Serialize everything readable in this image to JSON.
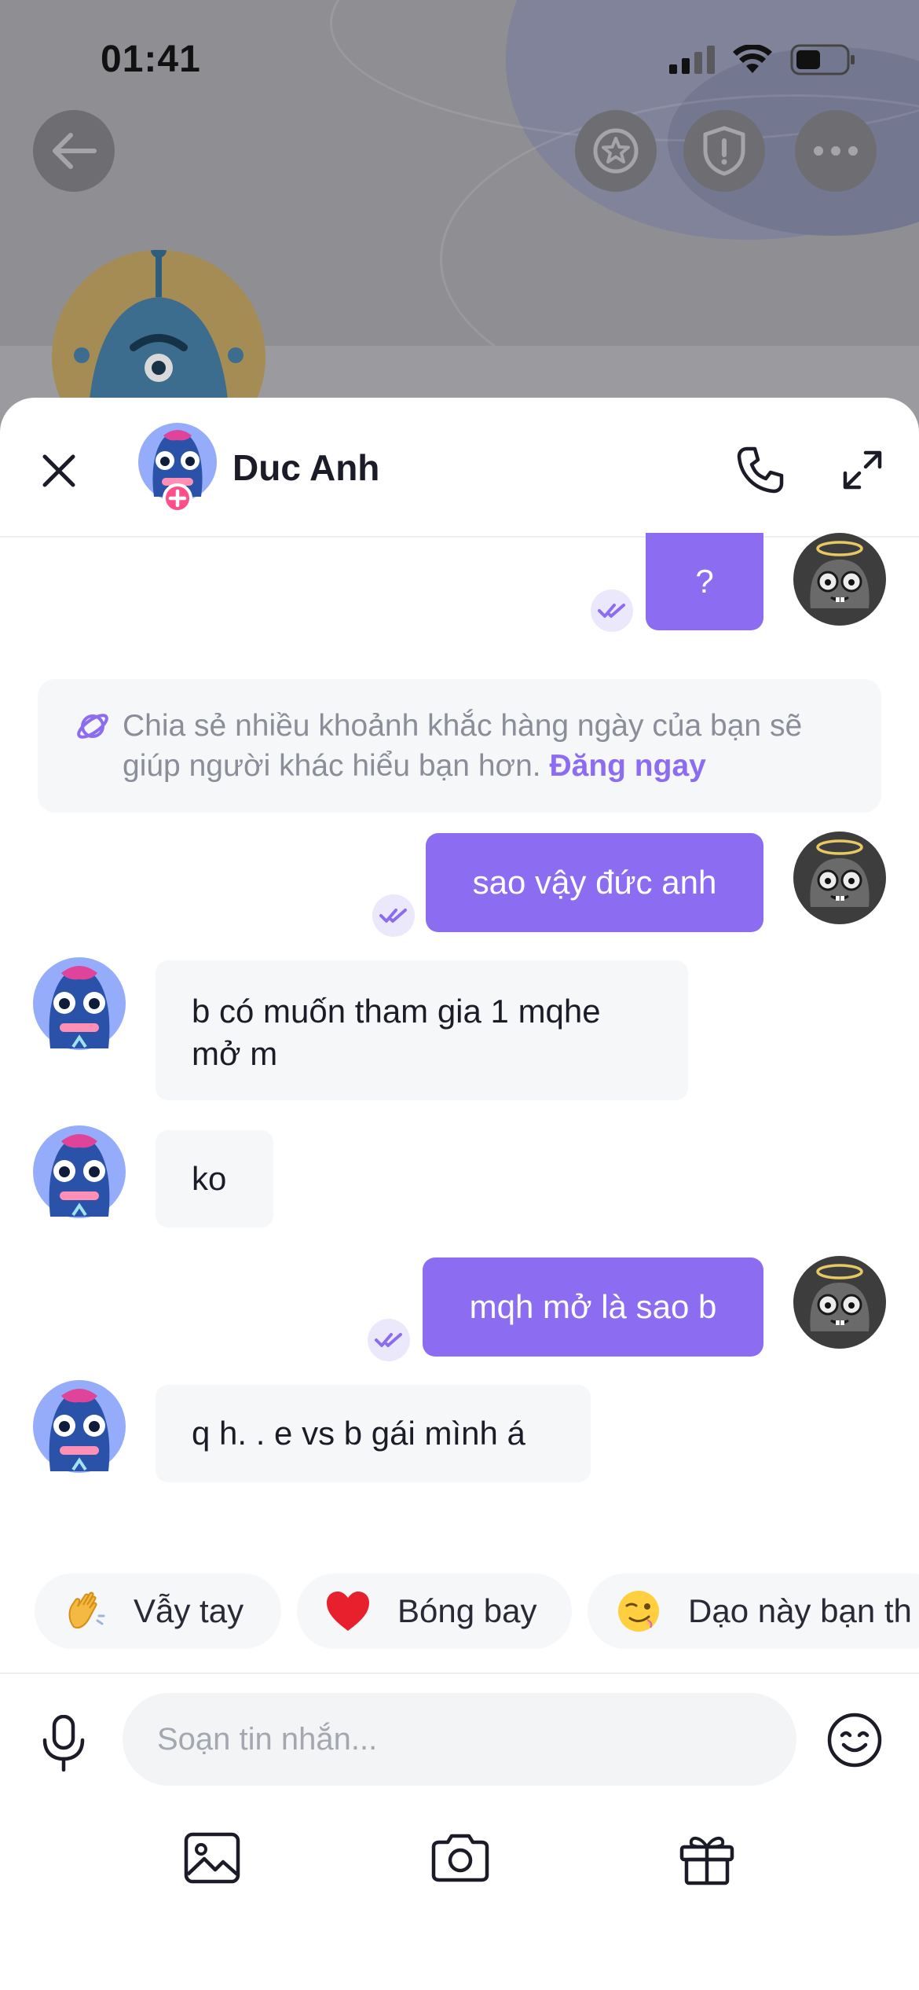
{
  "status_bar": {
    "time": "01:41"
  },
  "header": {
    "contact_name": "Duc Anh"
  },
  "messages": [
    {
      "direction": "out",
      "text": "?"
    },
    {
      "direction": "out",
      "text": "sao vậy đức anh"
    },
    {
      "direction": "in",
      "text": "b có muốn tham gia 1 mqhe mở m"
    },
    {
      "direction": "in",
      "text": "ko"
    },
    {
      "direction": "out",
      "text": "mqh mở là sao b"
    },
    {
      "direction": "in",
      "text": "q h. . e vs b gái mình á"
    }
  ],
  "tip": {
    "text": "Chia sẻ nhiều khoảnh khắc hàng ngày của bạn sẽ giúp người khác hiểu bạn hơn.",
    "link": "Đăng ngay"
  },
  "quick_replies": [
    {
      "emoji": "waving-hand",
      "label": "Vẫy tay"
    },
    {
      "emoji": "red-heart",
      "label": "Bóng bay"
    },
    {
      "emoji": "winking-face",
      "label": "Dạo này bạn th"
    }
  ],
  "composer": {
    "placeholder": "Soạn tin nhắn..."
  },
  "colors": {
    "accent": "#8C6CF0",
    "incoming_bubble": "#F6F7F9",
    "text": "#1C1C28",
    "muted": "#8B8D99"
  }
}
